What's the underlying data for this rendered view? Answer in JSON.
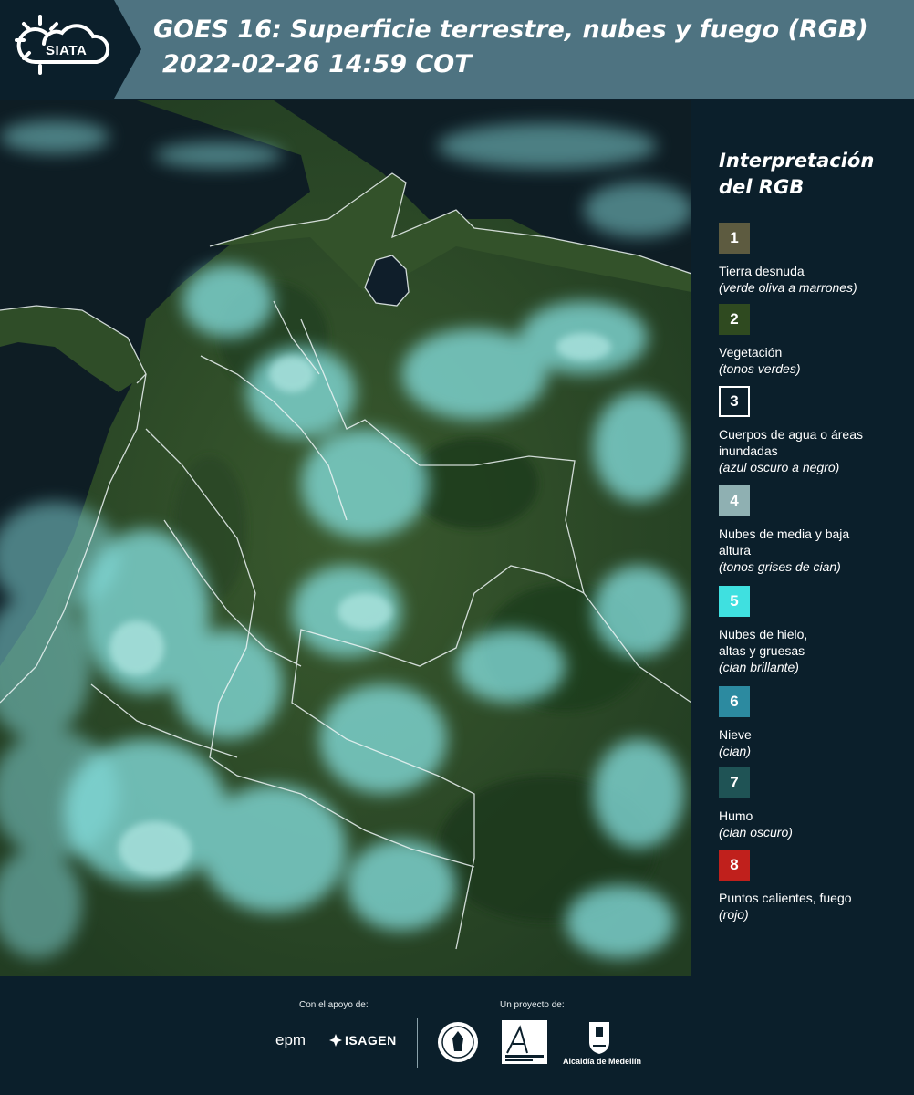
{
  "header": {
    "logo_text": "SIATA",
    "title": "GOES 16: Superficie terrestre, nubes y fuego (RGB)",
    "subtitle": "2022-02-26 14:59 COT"
  },
  "legend": {
    "title": "Interpretación del RGB",
    "items": [
      {
        "number": "1",
        "label": "Tierra desnuda",
        "desc": "(verde oliva a marrones)",
        "color": "#5d5b40"
      },
      {
        "number": "2",
        "label": "Vegetación",
        "desc": "(tonos verdes)",
        "color": "#2f4a20"
      },
      {
        "number": "3",
        "label": "Cuerpos de agua o áreas inundadas",
        "desc": "(azul oscuro a negro)",
        "color": "#0b1f2b"
      },
      {
        "number": "4",
        "label": "Nubes de media y baja altura",
        "desc": "(tonos grises de cian)",
        "color": "#8fb0b2"
      },
      {
        "number": "5",
        "label": "Nubes de hielo, altas y gruesas",
        "desc": "(cian brillante)",
        "color": "#3fe0e0"
      },
      {
        "number": "6",
        "label": "Nieve",
        "desc": "(cian)",
        "color": "#2c8aa0"
      },
      {
        "number": "7",
        "label": "Humo",
        "desc": "(cian oscuro)",
        "color": "#1f5355"
      },
      {
        "number": "8",
        "label": "Puntos calientes, fuego",
        "desc": "(rojo)",
        "color": "#c0201c"
      }
    ]
  },
  "footer": {
    "support_label": "Con el apoyo de:",
    "project_label": "Un proyecto de:",
    "epm": "epm",
    "isagen": "ISAGEN",
    "alcaldia": "Alcaldía de Medellín"
  },
  "colors": {
    "background": "#0b1f2b",
    "header_band": "#4e7381",
    "map_ocean": "#0e1d24",
    "vegetation": "#2e4a28",
    "cloud": "#7fd8d8",
    "border_lines": "#e8f0f0"
  }
}
